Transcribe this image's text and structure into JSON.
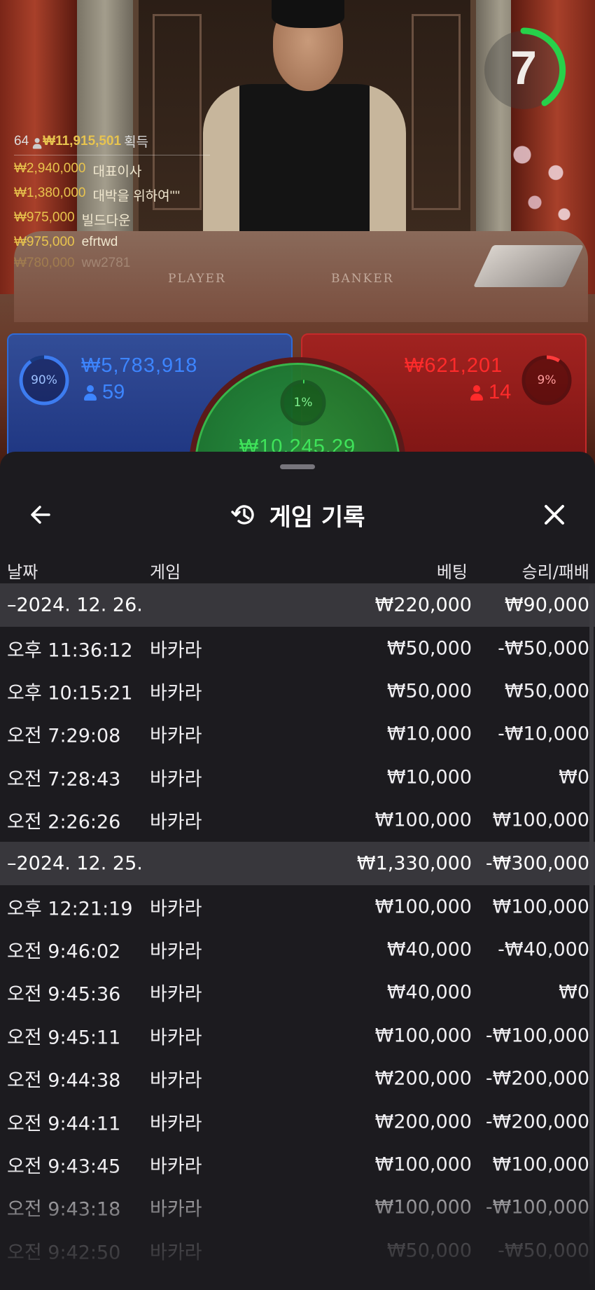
{
  "live": {
    "countdown": "7",
    "table_labels": {
      "player": "PLAYER",
      "banker": "BANKER"
    },
    "leaderboard": {
      "count": "64",
      "total": "₩11,915,501",
      "suffix": "획득",
      "entries": [
        {
          "amount": "₩2,940,000",
          "name": "대표이사"
        },
        {
          "amount": "₩1,380,000",
          "name": "대박을 위하여''''"
        },
        {
          "amount": "₩975,000",
          "name": "빌드다운"
        },
        {
          "amount": "₩975,000",
          "name": "efrtwd"
        },
        {
          "amount": "₩780,000",
          "name": "ww2781"
        }
      ]
    },
    "player_bet": {
      "percent": "90%",
      "amount": "₩5,783,918",
      "players": "59",
      "color": "#2f6bd8"
    },
    "banker_bet": {
      "percent": "9%",
      "amount": "₩621,201",
      "players": "14",
      "color": "#c52a2a"
    },
    "tie_bet": {
      "percent": "1%",
      "amount": "₩10,245.29",
      "color": "#3fe35a"
    }
  },
  "sheet": {
    "title": "게임 기록",
    "back_icon": "arrow-left-icon",
    "history_icon": "history-icon",
    "close_icon": "close-icon",
    "columns": {
      "date": "날짜",
      "game": "게임",
      "bet": "베팅",
      "result": "승리/패배"
    },
    "groups": [
      {
        "date": "–2024. 12. 26.",
        "bet": "₩220,000",
        "result": "₩90,000",
        "rows": [
          {
            "time": "오후 11:36:12",
            "game": "바카라",
            "bet": "₩50,000",
            "result": "-₩50,000"
          },
          {
            "time": "오후 10:15:21",
            "game": "바카라",
            "bet": "₩50,000",
            "result": "₩50,000"
          },
          {
            "time": "오전 7:29:08",
            "game": "바카라",
            "bet": "₩10,000",
            "result": "-₩10,000"
          },
          {
            "time": "오전 7:28:43",
            "game": "바카라",
            "bet": "₩10,000",
            "result": "₩0"
          },
          {
            "time": "오전 2:26:26",
            "game": "바카라",
            "bet": "₩100,000",
            "result": "₩100,000"
          }
        ]
      },
      {
        "date": "–2024. 12. 25.",
        "bet": "₩1,330,000",
        "result": "-₩300,000",
        "rows": [
          {
            "time": "오후 12:21:19",
            "game": "바카라",
            "bet": "₩100,000",
            "result": "₩100,000"
          },
          {
            "time": "오전 9:46:02",
            "game": "바카라",
            "bet": "₩40,000",
            "result": "-₩40,000"
          },
          {
            "time": "오전 9:45:36",
            "game": "바카라",
            "bet": "₩40,000",
            "result": "₩0"
          },
          {
            "time": "오전 9:45:11",
            "game": "바카라",
            "bet": "₩100,000",
            "result": "-₩100,000"
          },
          {
            "time": "오전 9:44:38",
            "game": "바카라",
            "bet": "₩200,000",
            "result": "-₩200,000"
          },
          {
            "time": "오전 9:44:11",
            "game": "바카라",
            "bet": "₩200,000",
            "result": "-₩200,000"
          },
          {
            "time": "오전 9:43:45",
            "game": "바카라",
            "bet": "₩100,000",
            "result": "₩100,000"
          },
          {
            "time": "오전 9:43:18",
            "game": "바카라",
            "bet": "₩100,000",
            "result": "-₩100,000"
          },
          {
            "time": "오전 9:42:50",
            "game": "바카라",
            "bet": "₩50,000",
            "result": "-₩50,000"
          }
        ]
      }
    ]
  }
}
